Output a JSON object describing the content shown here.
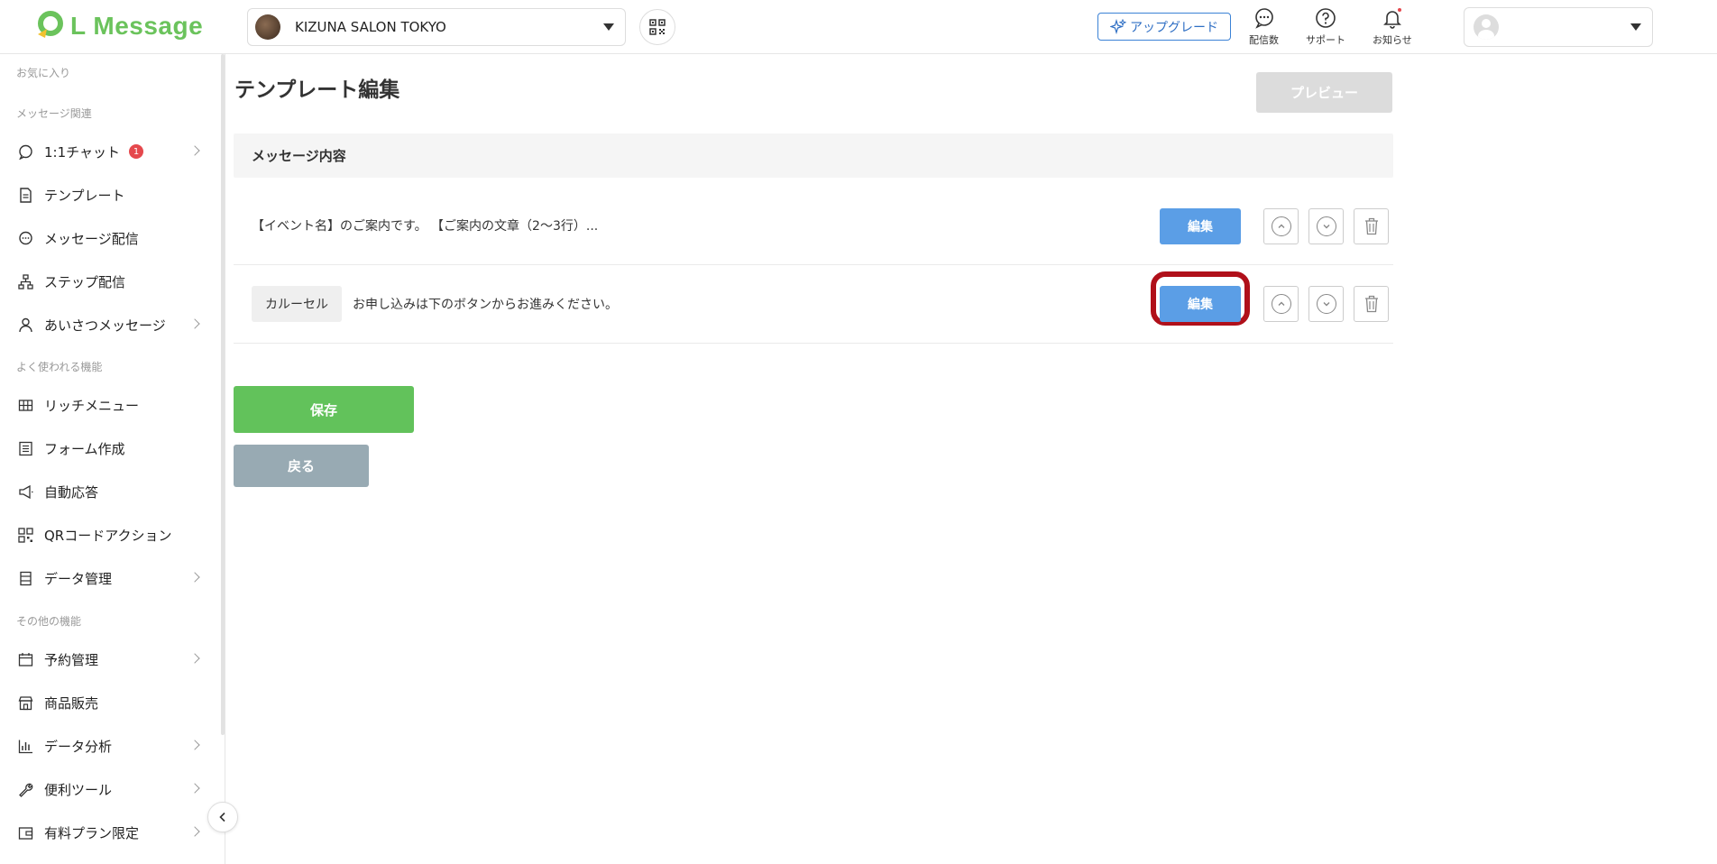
{
  "header": {
    "logo_text": "L Message",
    "account_name": "KIZUNA SALON TOKYO",
    "upgrade_label": "アップグレード",
    "icons": [
      {
        "name": "delivery-count-icon",
        "label": "配信数"
      },
      {
        "name": "support-icon",
        "label": "サポート"
      },
      {
        "name": "notification-icon",
        "label": "お知らせ"
      }
    ]
  },
  "sidebar": {
    "sections": {
      "favorites": "お気に入り",
      "message": "メッセージ関連",
      "frequent": "よく使われる機能",
      "other": "その他の機能"
    },
    "items": [
      {
        "label": "1:1チャット",
        "badge": "1"
      },
      {
        "label": "テンプレート"
      },
      {
        "label": "メッセージ配信"
      },
      {
        "label": "ステップ配信"
      },
      {
        "label": "あいさつメッセージ"
      },
      {
        "label": "リッチメニュー"
      },
      {
        "label": "フォーム作成"
      },
      {
        "label": "自動応答"
      },
      {
        "label": "QRコードアクション"
      },
      {
        "label": "データ管理"
      },
      {
        "label": "予約管理"
      },
      {
        "label": "商品販売"
      },
      {
        "label": "データ分析"
      },
      {
        "label": "便利ツール"
      },
      {
        "label": "有料プラン限定"
      }
    ]
  },
  "main": {
    "title": "テンプレート編集",
    "preview_label": "プレビュー",
    "section_header": "メッセージ内容",
    "messages": [
      {
        "tag": "",
        "text": "【イベント名】のご案内です。 【ご案内の文章（2〜3行）..."
      },
      {
        "tag": "カルーセル",
        "text": "お申し込みは下のボタンからお進みください。"
      }
    ],
    "edit_label": "編集",
    "save_label": "保存",
    "back_label": "戻る"
  },
  "colors": {
    "brand_green": "#6bc35c",
    "edit_blue": "#5b9ee6",
    "save_green": "#62c25b",
    "back_gray": "#98aab3",
    "highlight_red": "#b0101a",
    "badge_red": "#e5484d"
  }
}
